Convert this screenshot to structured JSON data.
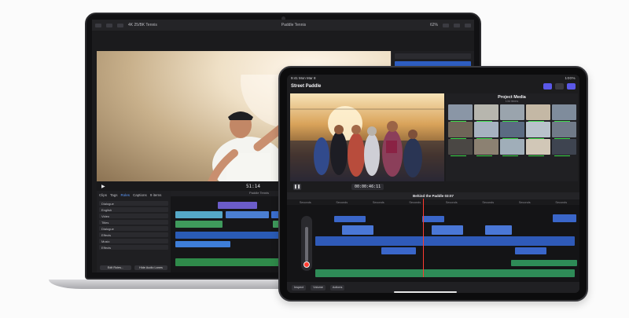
{
  "macbook": {
    "app_bar": {
      "left_label": "4K 25/BK Tennis",
      "center_title": "Paddle Tennis",
      "zoom": "62%"
    },
    "transport": {
      "timecode": "51:14"
    },
    "timeline_label": "Paddle Tennis",
    "browser": {
      "tabs": [
        "Clips",
        "Tags",
        "Roles",
        "Captions"
      ],
      "active_tab": "Roles",
      "extra": "9 items",
      "rows": [
        "Dialogue",
        "English",
        "Video",
        "Titles",
        "Dialogue",
        "Effects",
        "Music",
        "Effects"
      ],
      "left_button": "Edit Roles...",
      "right_button": "Hide Audio Lanes"
    }
  },
  "ipad": {
    "status_left": "9:41 Mon Mar 8",
    "status_right": "100%",
    "project_title": "Street Paddle",
    "media": {
      "title": "Project Media",
      "subtitle": "134 items"
    },
    "transport": {
      "timecode": "00:00:46:11"
    },
    "timeline": {
      "title": "Behind the Paddle",
      "duration": "03:07"
    },
    "ruler_ticks": [
      "Seconds",
      "Seconds",
      "Seconds",
      "Seconds",
      "Seconds",
      "Seconds",
      "Seconds",
      "Seconds"
    ],
    "bottom": {
      "inspect": "Inspect",
      "btn2": "Volume",
      "btn3": "Actions"
    }
  },
  "colors": {
    "accent": "#5a58e8",
    "clip_video": "#3a66c9",
    "clip_audio": "#2e8b57",
    "playhead": "#ff3b30"
  }
}
